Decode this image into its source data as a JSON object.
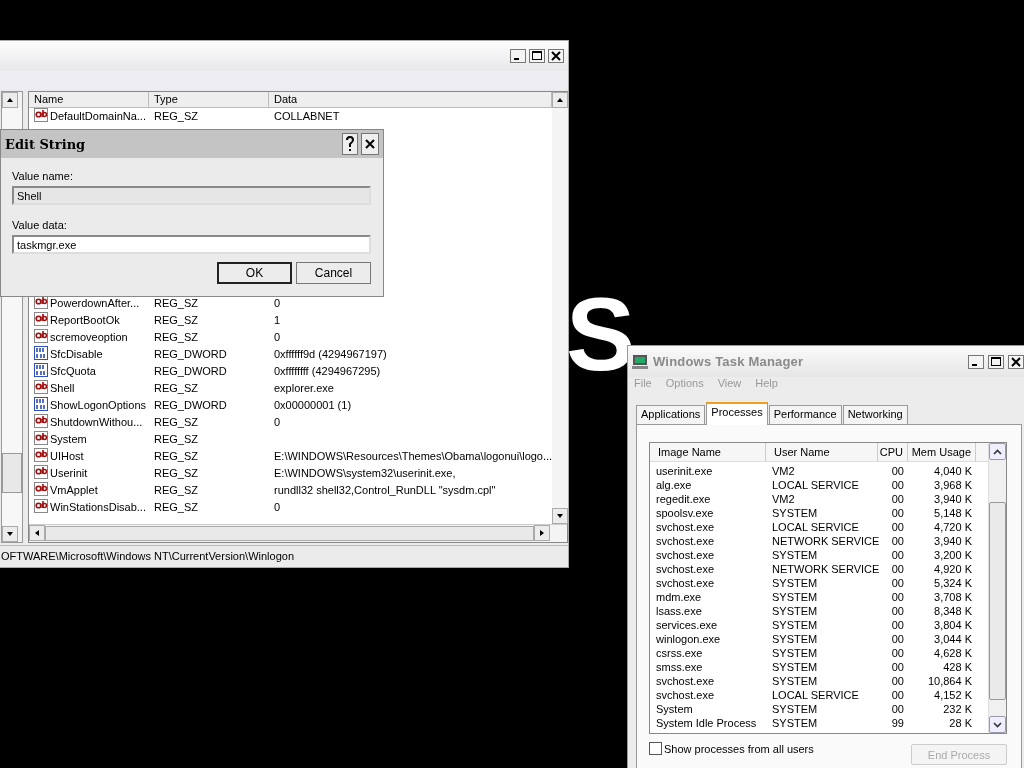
{
  "desktop": {
    "background_text": "S"
  },
  "registry_editor": {
    "columns": [
      "Name",
      "Type",
      "Data"
    ],
    "values": [
      {
        "kind": "string",
        "name": "DefaultDomainNa...",
        "type": "REG_SZ",
        "data": "COLLABNET",
        "hidden_after": true
      },
      {
        "kind": "string",
        "name": "PowerdownAfter...",
        "type": "REG_SZ",
        "data": "0"
      },
      {
        "kind": "string",
        "name": "ReportBootOk",
        "type": "REG_SZ",
        "data": "1"
      },
      {
        "kind": "string",
        "name": "scremoveoption",
        "type": "REG_SZ",
        "data": "0"
      },
      {
        "kind": "dword",
        "name": "SfcDisable",
        "type": "REG_DWORD",
        "data": "0xffffff9d (4294967197)"
      },
      {
        "kind": "dword",
        "name": "SfcQuota",
        "type": "REG_DWORD",
        "data": "0xffffffff (4294967295)"
      },
      {
        "kind": "string",
        "name": "Shell",
        "type": "REG_SZ",
        "data": "explorer.exe"
      },
      {
        "kind": "dword",
        "name": "ShowLogonOptions",
        "type": "REG_DWORD",
        "data": "0x00000001 (1)"
      },
      {
        "kind": "string",
        "name": "ShutdownWithou...",
        "type": "REG_SZ",
        "data": "0"
      },
      {
        "kind": "string",
        "name": "System",
        "type": "REG_SZ"
      },
      {
        "kind": "string",
        "name": "UIHost",
        "type": "REG_SZ",
        "data": "E:\\WINDOWS\\Resources\\Themes\\Obama\\logonui\\logo..."
      },
      {
        "kind": "string",
        "name": "Userinit",
        "type": "REG_SZ",
        "data": "E:\\WINDOWS\\system32\\userinit.exe,"
      },
      {
        "kind": "string",
        "name": "VmApplet",
        "type": "REG_SZ",
        "data": "rundll32 shell32,Control_RunDLL \"sysdm.cpl\""
      },
      {
        "kind": "string",
        "name": "WinStationsDisab...",
        "type": "REG_SZ",
        "data": "0"
      }
    ],
    "status_bar": "OFTWARE\\Microsoft\\Windows NT\\CurrentVersion\\Winlogon"
  },
  "edit_string_dialog": {
    "title": "Edit String",
    "value_name_label": "Value name:",
    "value_name": "Shell",
    "value_data_label": "Value data:",
    "value_data": "taskmgr.exe",
    "buttons": [
      {
        "label": "OK",
        "default": true
      },
      {
        "label": "Cancel",
        "default": false
      }
    ]
  },
  "task_manager": {
    "title": "Windows Task Manager",
    "active": false,
    "menu": [
      "File",
      "Options",
      "View",
      "Help"
    ],
    "tabs": [
      {
        "label": "Applications",
        "selected": false
      },
      {
        "label": "Processes",
        "selected": true
      },
      {
        "label": "Performance",
        "selected": false
      },
      {
        "label": "Networking",
        "selected": false
      }
    ],
    "columns": [
      "Image Name",
      "User Name",
      "CPU",
      "Mem Usage"
    ],
    "processes": [
      [
        "userinit.exe",
        "VM2",
        "00",
        "4,040 K"
      ],
      [
        "alg.exe",
        "LOCAL SERVICE",
        "00",
        "3,968 K"
      ],
      [
        "regedit.exe",
        "VM2",
        "00",
        "3,940 K"
      ],
      [
        "spoolsv.exe",
        "SYSTEM",
        "00",
        "5,148 K"
      ],
      [
        "svchost.exe",
        "LOCAL SERVICE",
        "00",
        "4,720 K"
      ],
      [
        "svchost.exe",
        "NETWORK SERVICE",
        "00",
        "3,940 K"
      ],
      [
        "svchost.exe",
        "SYSTEM",
        "00",
        "3,200 K"
      ],
      [
        "svchost.exe",
        "NETWORK SERVICE",
        "00",
        "4,920 K"
      ],
      [
        "svchost.exe",
        "SYSTEM",
        "00",
        "5,324 K"
      ],
      [
        "mdm.exe",
        "SYSTEM",
        "00",
        "3,708 K"
      ],
      [
        "lsass.exe",
        "SYSTEM",
        "00",
        "8,348 K"
      ],
      [
        "services.exe",
        "SYSTEM",
        "00",
        "3,804 K"
      ],
      [
        "winlogon.exe",
        "SYSTEM",
        "00",
        "3,044 K"
      ],
      [
        "csrss.exe",
        "SYSTEM",
        "00",
        "4,628 K"
      ],
      [
        "smss.exe",
        "SYSTEM",
        "00",
        "428 K"
      ],
      [
        "svchost.exe",
        "SYSTEM",
        "00",
        "10,864 K"
      ],
      [
        "svchost.exe",
        "LOCAL SERVICE",
        "00",
        "4,152 K"
      ],
      [
        "System",
        "SYSTEM",
        "00",
        "232 K"
      ],
      [
        "System Idle Process",
        "SYSTEM",
        "99",
        "28 K"
      ]
    ],
    "show_all_users": {
      "label": "Show processes from all users",
      "checked": false
    },
    "end_process": {
      "label": "End Process",
      "disabled": true
    }
  }
}
